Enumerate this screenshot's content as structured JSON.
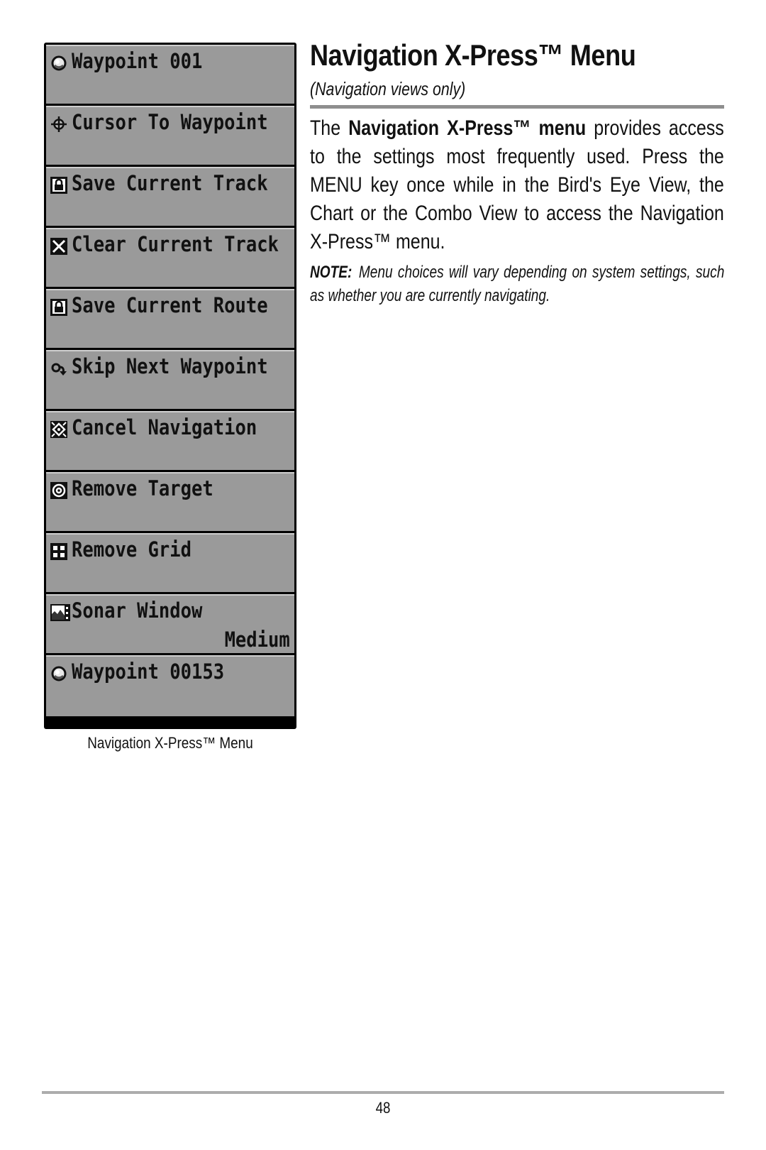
{
  "menu": {
    "items": [
      {
        "icon": "waypoint-icon",
        "label": "Waypoint 001",
        "value": ""
      },
      {
        "icon": "crosshair-icon",
        "label": "Cursor To Waypoint",
        "value": ""
      },
      {
        "icon": "save-lock-icon",
        "label": "Save Current Track",
        "value": ""
      },
      {
        "icon": "clear-x-icon",
        "label": "Clear Current Track",
        "value": ""
      },
      {
        "icon": "save-lock-icon",
        "label": "Save Current Route",
        "value": ""
      },
      {
        "icon": "skip-arrow-icon",
        "label": "Skip Next Waypoint",
        "value": ""
      },
      {
        "icon": "cancel-navigation-icon",
        "label": "Cancel Navigation",
        "value": ""
      },
      {
        "icon": "target-icon",
        "label": "Remove Target",
        "value": ""
      },
      {
        "icon": "grid-icon",
        "label": "Remove Grid",
        "value": ""
      },
      {
        "icon": "sonar-window-icon",
        "label": "Sonar Window",
        "value": "Medium"
      },
      {
        "icon": "waypoint-icon",
        "label": "Waypoint 00153",
        "value": ""
      }
    ],
    "caption": "Navigation X-Press™ Menu"
  },
  "content": {
    "title": "Navigation X-Press™ Menu",
    "subtitle": "(Navigation views only)",
    "paragraph": {
      "lead": "The ",
      "bold": "Navigation X-Press™ menu",
      "rest": " provides access to the settings most frequently used. Press the MENU key once while in the Bird's Eye View, the Chart or the Combo View to access the Navigation X-Press™ menu."
    },
    "note": {
      "label": "NOTE:",
      "text": "Menu choices will vary depending on system settings, such as whether you are currently navigating."
    }
  },
  "footer": {
    "page_number": "48"
  }
}
